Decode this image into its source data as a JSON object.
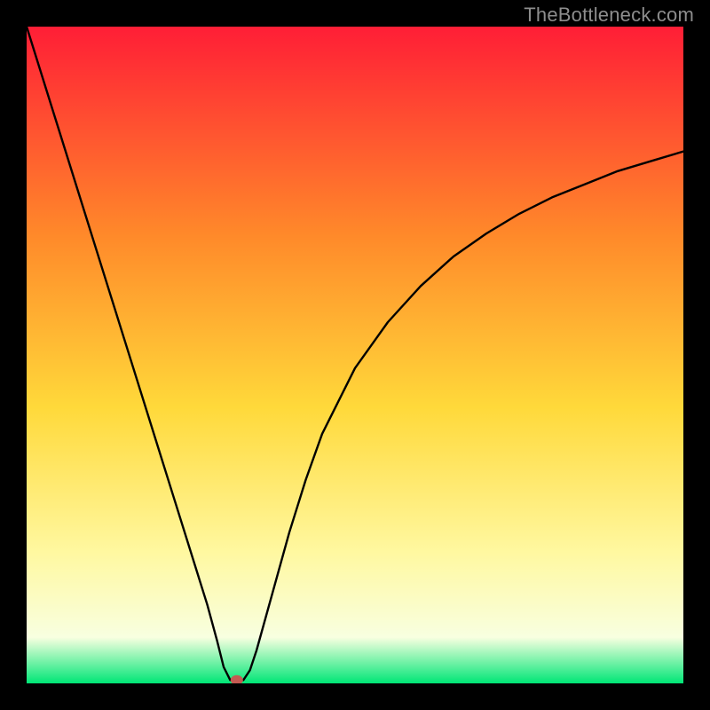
{
  "watermark": "TheBottleneck.com",
  "colors": {
    "gradient_top": "#ff1e36",
    "gradient_mid_upper": "#ff8a2a",
    "gradient_mid": "#ffd93a",
    "gradient_mid_lower": "#fff8a0",
    "gradient_lower": "#f8ffe0",
    "gradient_bottom": "#00e676",
    "frame": "#000000",
    "curve": "#000000",
    "marker": "#c45a52"
  },
  "chart_data": {
    "type": "line",
    "title": "",
    "xlabel": "",
    "ylabel": "",
    "xlim": [
      0,
      100
    ],
    "ylim": [
      0,
      100
    ],
    "x_ticks": [],
    "y_ticks": [],
    "grid": false,
    "legend": false,
    "series": [
      {
        "name": "bottleneck-curve",
        "x": [
          0,
          5,
          10,
          15,
          20,
          22.5,
          25,
          27.5,
          29,
          30,
          31,
          32,
          33,
          34,
          35,
          37.5,
          40,
          42.5,
          45,
          50,
          55,
          60,
          65,
          70,
          75,
          80,
          85,
          90,
          95,
          100
        ],
        "values": [
          100,
          84,
          68,
          52,
          36,
          28,
          20,
          12,
          6.5,
          2.5,
          0.5,
          0.5,
          0.5,
          2,
          5,
          14,
          23,
          31,
          38,
          48,
          55,
          60.5,
          65,
          68.5,
          71.5,
          74,
          76,
          78,
          79.5,
          81
        ]
      }
    ],
    "markers": [
      {
        "name": "optimal-point",
        "x": 32,
        "y": 0.5
      }
    ]
  }
}
